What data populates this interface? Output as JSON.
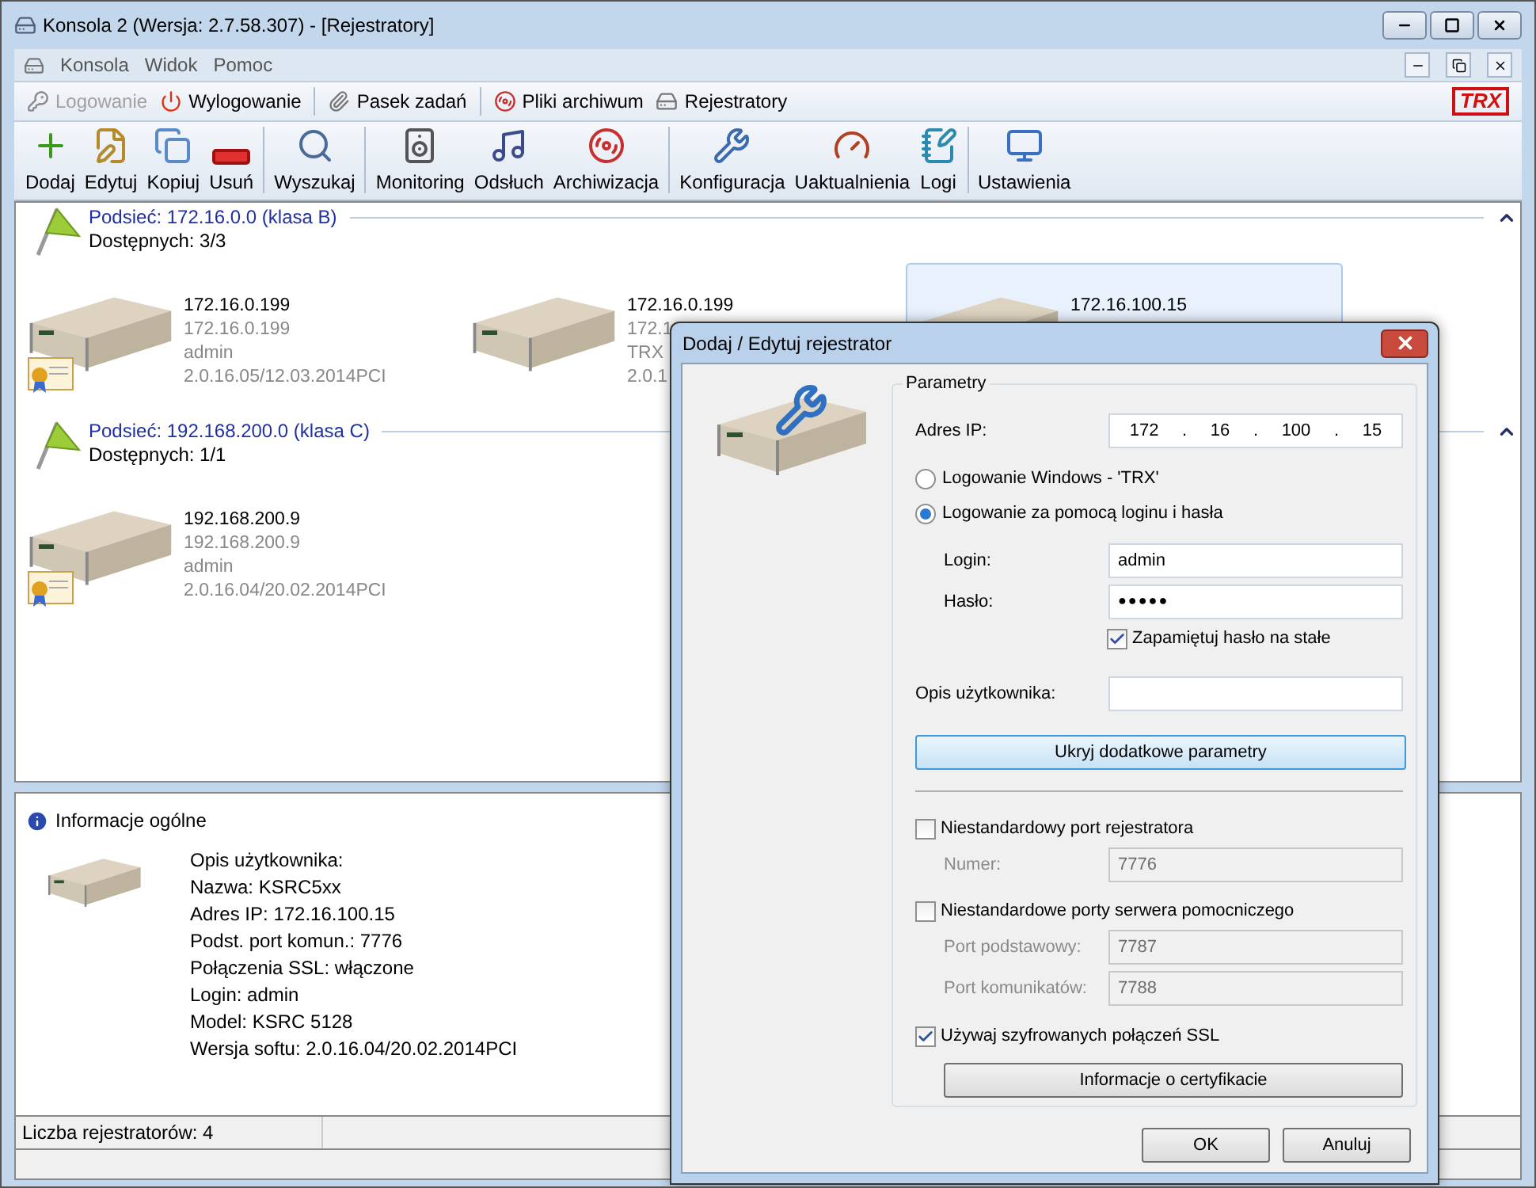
{
  "window": {
    "title": "Konsola 2 (Wersja:  2.7.58.307) - [Rejestratory]"
  },
  "menu": [
    "Konsola",
    "Widok",
    "Pomoc"
  ],
  "quick_toolbar": [
    {
      "label": "Logowanie",
      "kind": "key",
      "disabled": true
    },
    {
      "label": "Wylogowanie",
      "kind": "power",
      "disabled": false
    },
    {
      "label": "Pasek zadań",
      "kind": "clip",
      "disabled": false
    },
    {
      "label": "Pliki archiwum",
      "kind": "disc",
      "disabled": false
    },
    {
      "label": "Rejestratory",
      "kind": "device",
      "disabled": false
    }
  ],
  "logo": "TRX",
  "toolbar_groups": [
    [
      {
        "label": "Dodaj",
        "kind": "add"
      },
      {
        "label": "Edytuj",
        "kind": "edit"
      },
      {
        "label": "Kopiuj",
        "kind": "copy"
      },
      {
        "label": "Usuń",
        "kind": "remove"
      }
    ],
    [
      {
        "label": "Wyszukaj",
        "kind": "search"
      }
    ],
    [
      {
        "label": "Monitoring",
        "kind": "speaker"
      },
      {
        "label": "Odsłuch",
        "kind": "music"
      },
      {
        "label": "Archiwizacja",
        "kind": "disc"
      }
    ],
    [
      {
        "label": "Konfiguracja",
        "kind": "tools"
      },
      {
        "label": "Uaktualnienia",
        "kind": "gauge"
      },
      {
        "label": "Logi",
        "kind": "notebook"
      }
    ],
    [
      {
        "label": "Ustawienia",
        "kind": "monitor"
      }
    ]
  ],
  "subnets": [
    {
      "title": "Podsieć: 172.16.0.0 (klasa B)",
      "available": "Dostępnych: 3/3",
      "expanded": true,
      "devices": [
        {
          "name": "172.16.0.199",
          "ip": "172.16.0.199",
          "user": "admin",
          "version": "2.0.16.05/12.03.2014PCI",
          "certificate": true,
          "selected": false
        },
        {
          "name": "172.16.0.199",
          "ip": "172.1",
          "user": "TRX",
          "version": "2.0.1",
          "certificate": false,
          "selected": false
        },
        {
          "name": "172.16.100.15",
          "certificate": false,
          "selected": true
        }
      ]
    },
    {
      "title": "Podsieć: 192.168.200.0 (klasa C)",
      "available": "Dostępnych: 1/1",
      "expanded": true,
      "devices": [
        {
          "name": "192.168.200.9",
          "ip": "192.168.200.9",
          "user": "admin",
          "version": "2.0.16.04/20.02.2014PCI",
          "certificate": true,
          "selected": false
        }
      ]
    }
  ],
  "info_panel": {
    "title": "Informacje ogólne",
    "lines": [
      "Opis użytkownika:",
      "Nazwa: KSRC5xx",
      "Adres IP: 172.16.100.15",
      "Podst. port komun.: 7776",
      "Połączenia SSL: włączone",
      "Login: admin",
      "Model: KSRC 5128",
      "Wersja softu: 2.0.16.04/20.02.2014PCI"
    ]
  },
  "status_bar": {
    "count": "Liczba rejestratorów: 4"
  },
  "dialog": {
    "title": "Dodaj / Edytuj rejestrator",
    "group": "Parametry",
    "ip": {
      "label": "Adres IP:",
      "parts": [
        "172",
        ".",
        "16",
        ".",
        "100",
        ".",
        "15"
      ]
    },
    "login_modes": [
      {
        "label": "Logowanie Windows - 'TRX'",
        "selected": false
      },
      {
        "label": "Logowanie za pomocą loginu i hasła",
        "selected": true
      }
    ],
    "login": {
      "label": "Login:",
      "value": "admin"
    },
    "password": {
      "label": "Hasło:",
      "value": "●●●●●"
    },
    "remember": {
      "label": "Zapamiętuj hasło na stałe",
      "checked": true
    },
    "description": {
      "label": "Opis użytkownika:"
    },
    "toggle_button": "Ukryj dodatkowe parametry",
    "port_groups": [
      {
        "label": "Niestandardowy port rejestratora",
        "checked": false,
        "fields": [
          {
            "label": "Numer:",
            "value": "7776"
          }
        ]
      },
      {
        "label": "Niestandardowe porty serwera pomocniczego",
        "checked": false,
        "fields": [
          {
            "label": "Port podstawowy:",
            "value": "7787"
          },
          {
            "label": "Port komunikatów:",
            "value": "7788"
          }
        ]
      }
    ],
    "ssl": {
      "label": "Używaj szyfrowanych połączeń SSL",
      "checked": true
    },
    "cert_button": "Informacje o certyfikacie",
    "buttons": [
      "OK",
      "Anuluj"
    ]
  }
}
